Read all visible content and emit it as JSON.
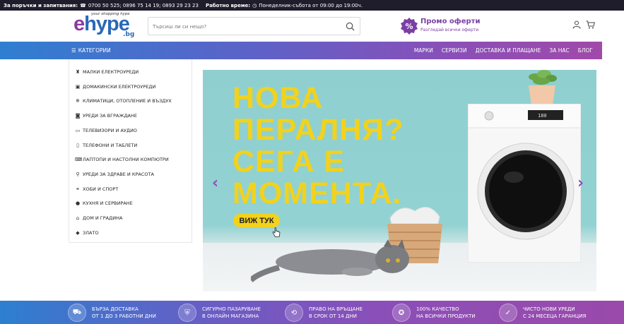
{
  "topbar": {
    "orders_label": "За поръчки и запитвания:",
    "phones": "0700 50 525; 0896 75 14 19; 0893 29 23 23",
    "hours_label": "Работно време:",
    "hours": "Понеделник-събота от 09:00 до 19:00ч."
  },
  "header": {
    "logo_tag": "your shopping hype",
    "logo_e": "e",
    "logo_rest": "hype",
    "logo_domain": ".bg",
    "search_placeholder": "Търсиш ли си нещо?",
    "promo_title": "Промо оферти",
    "promo_subtitle": "Разгледай всички оферти"
  },
  "nav": {
    "categories_label": "КАТЕГОРИИ",
    "links": [
      "МАРКИ",
      "СЕРВИЗИ",
      "ДОСТАВКА И ПЛАЩАНЕ",
      "ЗА НАС",
      "БЛОГ"
    ]
  },
  "sidebar": {
    "items": [
      {
        "icon": "blender-icon",
        "label": "МАЛКИ ЕЛЕКТРОУРЕДИ"
      },
      {
        "icon": "fridge-icon",
        "label": "ДОМАКИНСКИ ЕЛЕКТРОУРЕДИ"
      },
      {
        "icon": "snowflake-icon",
        "label": "КЛИМАТИЦИ, ОТОПЛЕНИЕ И ВЪЗДУХ"
      },
      {
        "icon": "oven-icon",
        "label": "УРЕДИ ЗА ВГРАЖДАНЕ"
      },
      {
        "icon": "tv-icon",
        "label": "ТЕЛЕВИЗОРИ И АУДИО"
      },
      {
        "icon": "phone-icon",
        "label": "ТЕЛЕФОНИ И ТАБЛЕТИ"
      },
      {
        "icon": "laptop-icon",
        "label": "ЛАПТОПИ И НАСТОЛНИ КОМПЮТРИ"
      },
      {
        "icon": "hairdryer-icon",
        "label": "УРЕДИ ЗА ЗДРАВЕ И КРАСОТА"
      },
      {
        "icon": "bicycle-icon",
        "label": "ХОБИ И СПОРТ"
      },
      {
        "icon": "pot-icon",
        "label": "КУХНЯ И СЕРВИРАНЕ"
      },
      {
        "icon": "house-icon",
        "label": "ДОМ И ГРАДИНА"
      },
      {
        "icon": "gold-icon",
        "label": "ЗЛАТО"
      }
    ]
  },
  "banner": {
    "headline_lines": [
      "НОВА",
      "ПЕРАЛНЯ?",
      "СЕГА Е",
      "МОМЕНТА."
    ],
    "cta_label": "ВИЖ ТУК",
    "washer_display": "180"
  },
  "features": [
    {
      "icon": "truck-icon",
      "line1": "БЪРЗА ДОСТАВКА",
      "line2": "ОТ 1 ДО 3 РАБОТНИ ДНИ"
    },
    {
      "icon": "shield-icon",
      "line1": "СИГУРНО ПАЗАРУВАНЕ",
      "line2": "В ОНЛАЙН МАГАЗИНА"
    },
    {
      "icon": "return-icon",
      "line1": "ПРАВО НА ВРЪЩАНЕ",
      "line2": "В СРОК ОТ 14 ДНИ"
    },
    {
      "icon": "quality-badge-icon",
      "line1": "100% КАЧЕСТВО",
      "line2": "НА ВСИЧКИ ПРОДУКТИ"
    },
    {
      "icon": "warranty-icon",
      "line1": "ЧИСТО НОВИ УРЕДИ",
      "line2": "С 24 МЕСЕЦА ГАРАНЦИЯ"
    }
  ],
  "colors": {
    "brand_purple": "#8a4fb8",
    "brand_blue": "#2f7fd1",
    "banner_yellow": "#f2d21c"
  }
}
